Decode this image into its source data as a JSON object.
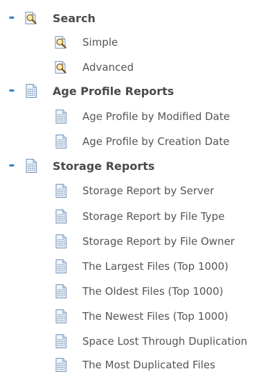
{
  "tree": {
    "groups": [
      {
        "label": "Search",
        "toggle": "-",
        "icon": "magnifier-document-icon",
        "items": [
          {
            "label": "Simple",
            "icon": "magnifier-document-icon"
          },
          {
            "label": "Advanced",
            "icon": "magnifier-document-icon"
          }
        ]
      },
      {
        "label": "Age Profile Reports",
        "toggle": "-",
        "icon": "report-document-icon",
        "items": [
          {
            "label": "Age Profile by Modified Date",
            "icon": "report-document-icon"
          },
          {
            "label": "Age Profile by Creation Date",
            "icon": "report-document-icon"
          }
        ]
      },
      {
        "label": "Storage Reports",
        "toggle": "-",
        "icon": "report-document-icon",
        "items": [
          {
            "label": "Storage Report by Server",
            "icon": "report-document-icon"
          },
          {
            "label": "Storage Report by File Type",
            "icon": "report-document-icon"
          },
          {
            "label": "Storage Report by File Owner",
            "icon": "report-document-icon"
          },
          {
            "label": "The Largest Files (Top 1000)",
            "icon": "report-document-icon"
          },
          {
            "label": "The Oldest Files (Top 1000)",
            "icon": "report-document-icon"
          },
          {
            "label": "The Newest Files (Top 1000)",
            "icon": "report-document-icon"
          },
          {
            "label": "Space Lost Through Duplication",
            "icon": "report-document-icon"
          },
          {
            "label": "The Most Duplicated Files",
            "icon": "report-document-icon"
          }
        ]
      }
    ]
  },
  "colors": {
    "toggle": "#3c7fc2",
    "group_text": "#4a4a4a",
    "item_text": "#555555"
  }
}
